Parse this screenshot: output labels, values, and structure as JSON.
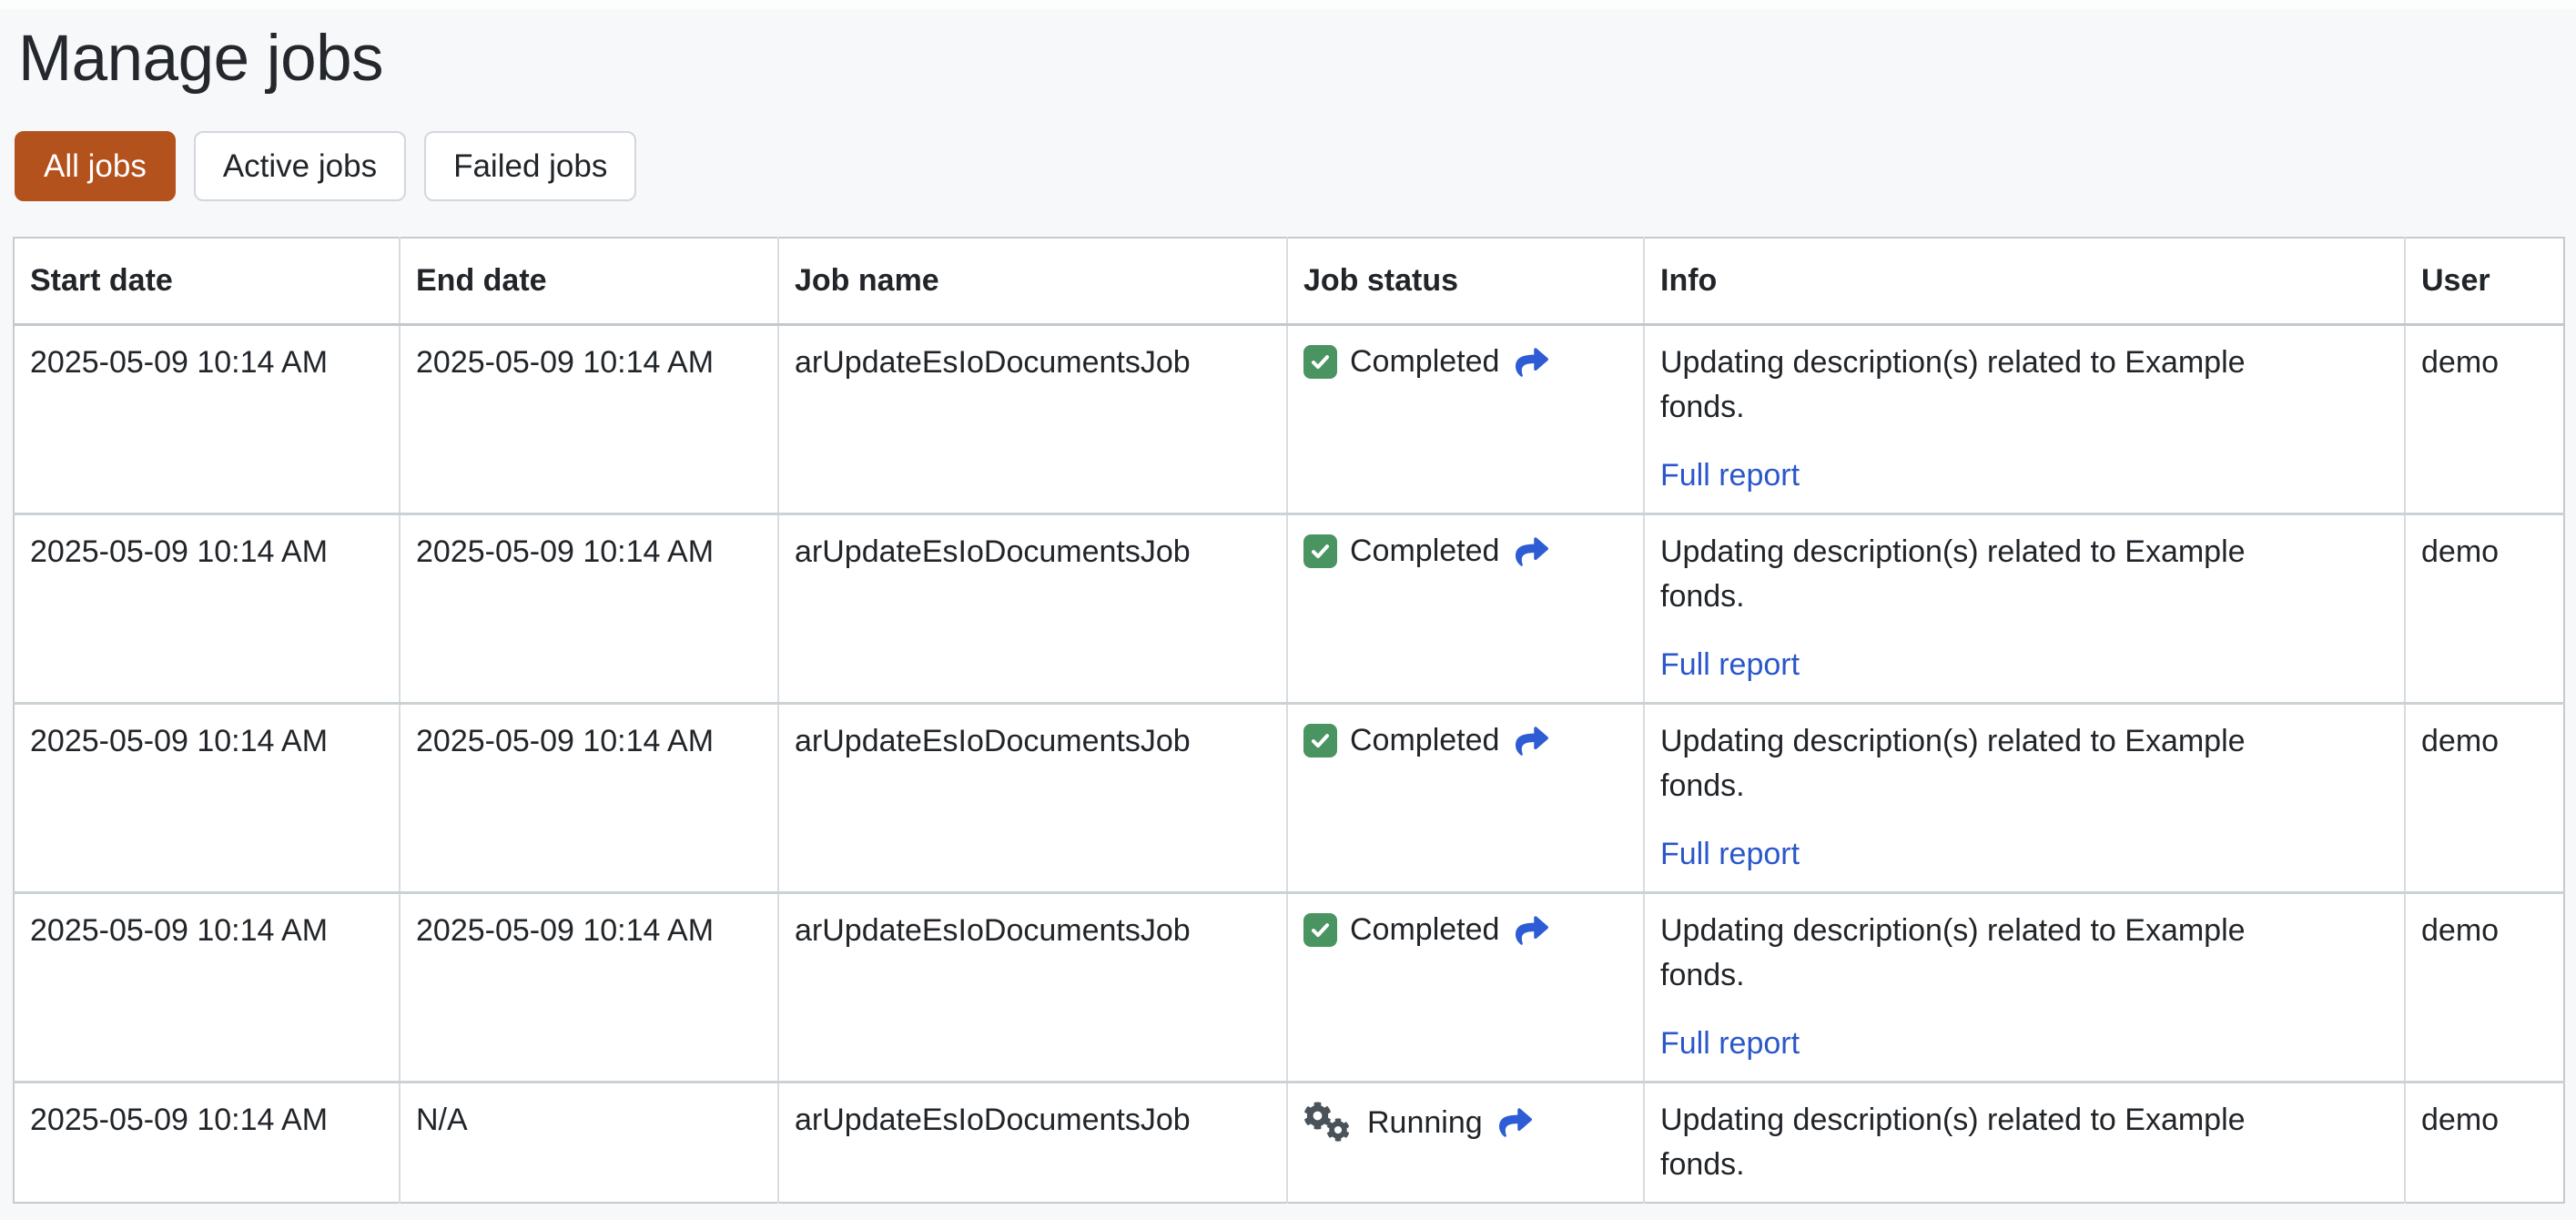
{
  "page": {
    "title": "Manage jobs"
  },
  "filters": {
    "items": [
      {
        "label": "All jobs",
        "active": true
      },
      {
        "label": "Active jobs",
        "active": false
      },
      {
        "label": "Failed jobs",
        "active": false
      }
    ]
  },
  "colors": {
    "page_bg": "#f7f8f9",
    "accent_active_filter": "#b4521e",
    "link_blue": "#2a57c9",
    "share_arrow_blue": "#2e5cd4",
    "status_success_green": "#4a9462",
    "gear_gray": "#4a525a"
  },
  "jobs_table": {
    "columns": [
      {
        "key": "start_date",
        "label": "Start date"
      },
      {
        "key": "end_date",
        "label": "End date"
      },
      {
        "key": "job_name",
        "label": "Job name"
      },
      {
        "key": "job_status",
        "label": "Job status"
      },
      {
        "key": "info",
        "label": "Info"
      },
      {
        "key": "user",
        "label": "User"
      }
    ],
    "rows": [
      {
        "start_date": "2025-05-09 10:14 AM",
        "end_date": "2025-05-09 10:14 AM",
        "job_name": "arUpdateEsIoDocumentsJob",
        "status": "Completed",
        "status_icon": "check-square-icon",
        "info_lines": [
          "Updating description(s) related to Example",
          "fonds."
        ],
        "report_link": "Full report",
        "user": "demo"
      },
      {
        "start_date": "2025-05-09 10:14 AM",
        "end_date": "2025-05-09 10:14 AM",
        "job_name": "arUpdateEsIoDocumentsJob",
        "status": "Completed",
        "status_icon": "check-square-icon",
        "info_lines": [
          "Updating description(s) related to Example",
          "fonds."
        ],
        "report_link": "Full report",
        "user": "demo"
      },
      {
        "start_date": "2025-05-09 10:14 AM",
        "end_date": "2025-05-09 10:14 AM",
        "job_name": "arUpdateEsIoDocumentsJob",
        "status": "Completed",
        "status_icon": "check-square-icon",
        "info_lines": [
          "Updating description(s) related to Example",
          "fonds."
        ],
        "report_link": "Full report",
        "user": "demo"
      },
      {
        "start_date": "2025-05-09 10:14 AM",
        "end_date": "2025-05-09 10:14 AM",
        "job_name": "arUpdateEsIoDocumentsJob",
        "status": "Completed",
        "status_icon": "check-square-icon",
        "info_lines": [
          "Updating description(s) related to Example",
          "fonds."
        ],
        "report_link": "Full report",
        "user": "demo"
      },
      {
        "start_date": "2025-05-09 10:14 AM",
        "end_date": "N/A",
        "job_name": "arUpdateEsIoDocumentsJob",
        "status": "Running",
        "status_icon": "gears-icon",
        "info_lines": [
          "Updating description(s) related to Example",
          "fonds."
        ],
        "report_link": null,
        "user": "demo"
      }
    ]
  }
}
